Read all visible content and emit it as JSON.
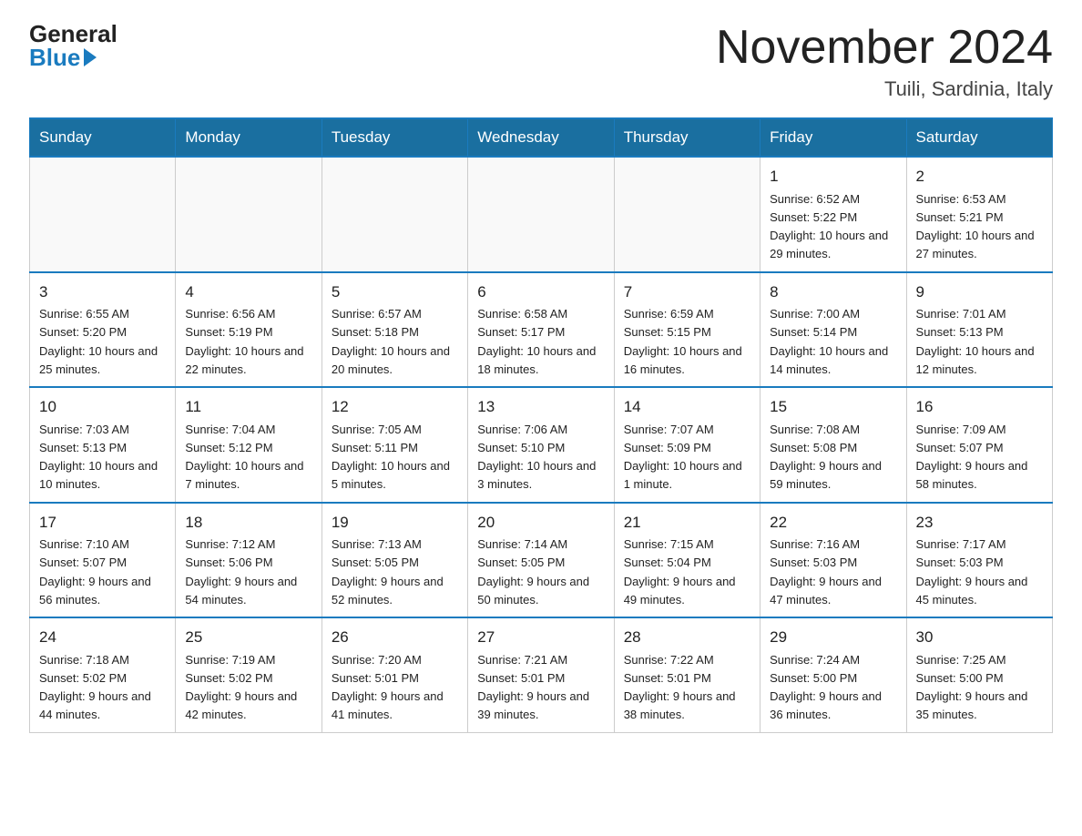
{
  "header": {
    "logo_general": "General",
    "logo_blue": "Blue",
    "title": "November 2024",
    "subtitle": "Tuili, Sardinia, Italy"
  },
  "weekdays": [
    "Sunday",
    "Monday",
    "Tuesday",
    "Wednesday",
    "Thursday",
    "Friday",
    "Saturday"
  ],
  "rows": [
    [
      {
        "day": "",
        "info": ""
      },
      {
        "day": "",
        "info": ""
      },
      {
        "day": "",
        "info": ""
      },
      {
        "day": "",
        "info": ""
      },
      {
        "day": "",
        "info": ""
      },
      {
        "day": "1",
        "info": "Sunrise: 6:52 AM\nSunset: 5:22 PM\nDaylight: 10 hours and 29 minutes."
      },
      {
        "day": "2",
        "info": "Sunrise: 6:53 AM\nSunset: 5:21 PM\nDaylight: 10 hours and 27 minutes."
      }
    ],
    [
      {
        "day": "3",
        "info": "Sunrise: 6:55 AM\nSunset: 5:20 PM\nDaylight: 10 hours and 25 minutes."
      },
      {
        "day": "4",
        "info": "Sunrise: 6:56 AM\nSunset: 5:19 PM\nDaylight: 10 hours and 22 minutes."
      },
      {
        "day": "5",
        "info": "Sunrise: 6:57 AM\nSunset: 5:18 PM\nDaylight: 10 hours and 20 minutes."
      },
      {
        "day": "6",
        "info": "Sunrise: 6:58 AM\nSunset: 5:17 PM\nDaylight: 10 hours and 18 minutes."
      },
      {
        "day": "7",
        "info": "Sunrise: 6:59 AM\nSunset: 5:15 PM\nDaylight: 10 hours and 16 minutes."
      },
      {
        "day": "8",
        "info": "Sunrise: 7:00 AM\nSunset: 5:14 PM\nDaylight: 10 hours and 14 minutes."
      },
      {
        "day": "9",
        "info": "Sunrise: 7:01 AM\nSunset: 5:13 PM\nDaylight: 10 hours and 12 minutes."
      }
    ],
    [
      {
        "day": "10",
        "info": "Sunrise: 7:03 AM\nSunset: 5:13 PM\nDaylight: 10 hours and 10 minutes."
      },
      {
        "day": "11",
        "info": "Sunrise: 7:04 AM\nSunset: 5:12 PM\nDaylight: 10 hours and 7 minutes."
      },
      {
        "day": "12",
        "info": "Sunrise: 7:05 AM\nSunset: 5:11 PM\nDaylight: 10 hours and 5 minutes."
      },
      {
        "day": "13",
        "info": "Sunrise: 7:06 AM\nSunset: 5:10 PM\nDaylight: 10 hours and 3 minutes."
      },
      {
        "day": "14",
        "info": "Sunrise: 7:07 AM\nSunset: 5:09 PM\nDaylight: 10 hours and 1 minute."
      },
      {
        "day": "15",
        "info": "Sunrise: 7:08 AM\nSunset: 5:08 PM\nDaylight: 9 hours and 59 minutes."
      },
      {
        "day": "16",
        "info": "Sunrise: 7:09 AM\nSunset: 5:07 PM\nDaylight: 9 hours and 58 minutes."
      }
    ],
    [
      {
        "day": "17",
        "info": "Sunrise: 7:10 AM\nSunset: 5:07 PM\nDaylight: 9 hours and 56 minutes."
      },
      {
        "day": "18",
        "info": "Sunrise: 7:12 AM\nSunset: 5:06 PM\nDaylight: 9 hours and 54 minutes."
      },
      {
        "day": "19",
        "info": "Sunrise: 7:13 AM\nSunset: 5:05 PM\nDaylight: 9 hours and 52 minutes."
      },
      {
        "day": "20",
        "info": "Sunrise: 7:14 AM\nSunset: 5:05 PM\nDaylight: 9 hours and 50 minutes."
      },
      {
        "day": "21",
        "info": "Sunrise: 7:15 AM\nSunset: 5:04 PM\nDaylight: 9 hours and 49 minutes."
      },
      {
        "day": "22",
        "info": "Sunrise: 7:16 AM\nSunset: 5:03 PM\nDaylight: 9 hours and 47 minutes."
      },
      {
        "day": "23",
        "info": "Sunrise: 7:17 AM\nSunset: 5:03 PM\nDaylight: 9 hours and 45 minutes."
      }
    ],
    [
      {
        "day": "24",
        "info": "Sunrise: 7:18 AM\nSunset: 5:02 PM\nDaylight: 9 hours and 44 minutes."
      },
      {
        "day": "25",
        "info": "Sunrise: 7:19 AM\nSunset: 5:02 PM\nDaylight: 9 hours and 42 minutes."
      },
      {
        "day": "26",
        "info": "Sunrise: 7:20 AM\nSunset: 5:01 PM\nDaylight: 9 hours and 41 minutes."
      },
      {
        "day": "27",
        "info": "Sunrise: 7:21 AM\nSunset: 5:01 PM\nDaylight: 9 hours and 39 minutes."
      },
      {
        "day": "28",
        "info": "Sunrise: 7:22 AM\nSunset: 5:01 PM\nDaylight: 9 hours and 38 minutes."
      },
      {
        "day": "29",
        "info": "Sunrise: 7:24 AM\nSunset: 5:00 PM\nDaylight: 9 hours and 36 minutes."
      },
      {
        "day": "30",
        "info": "Sunrise: 7:25 AM\nSunset: 5:00 PM\nDaylight: 9 hours and 35 minutes."
      }
    ]
  ]
}
